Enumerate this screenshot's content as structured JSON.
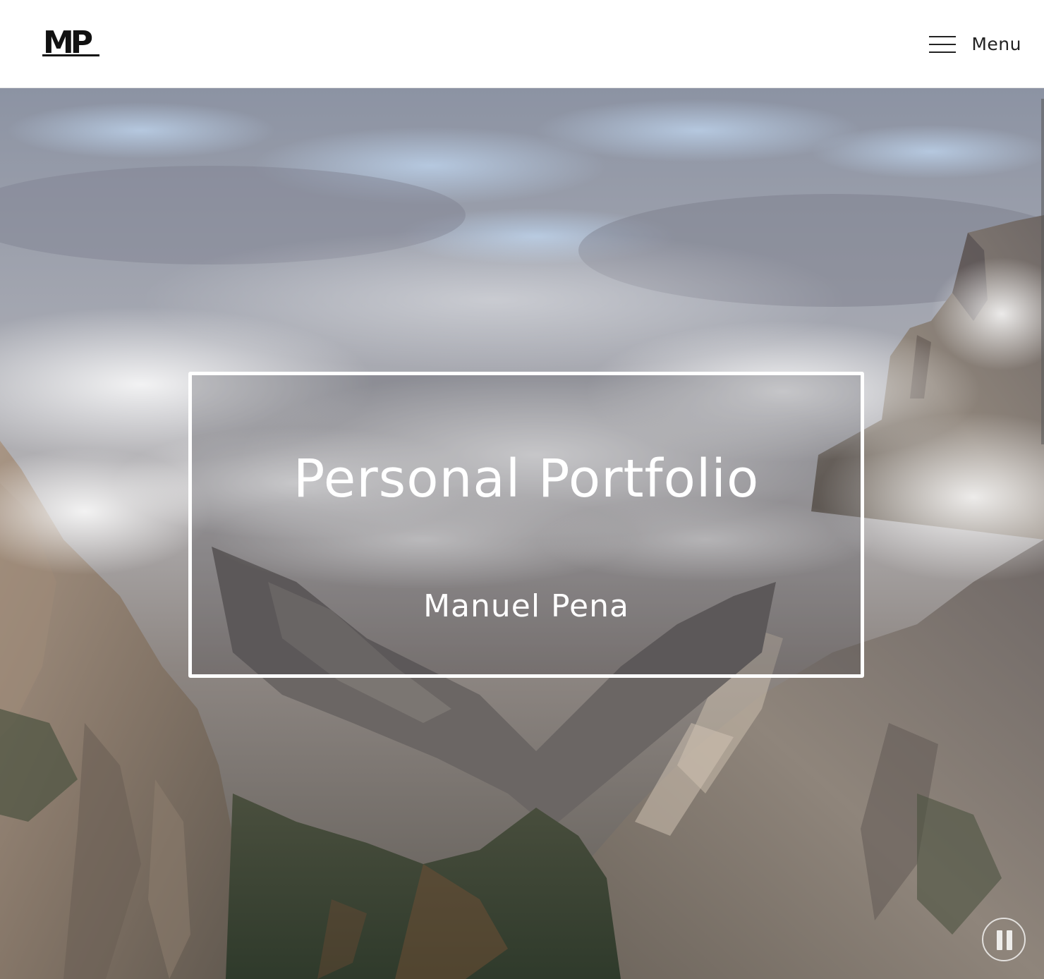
{
  "header": {
    "logo_text": "MP",
    "menu_label": "Menu"
  },
  "hero": {
    "title": "Personal Portfolio",
    "subtitle": "Manuel Pena",
    "background": "mountain valley with clouds",
    "pause_icon": "pause-icon"
  },
  "colors": {
    "header_bg": "#ffffff",
    "text_dark": "#111111",
    "hero_text": "#ffffff",
    "frame_border": "#ffffff"
  }
}
